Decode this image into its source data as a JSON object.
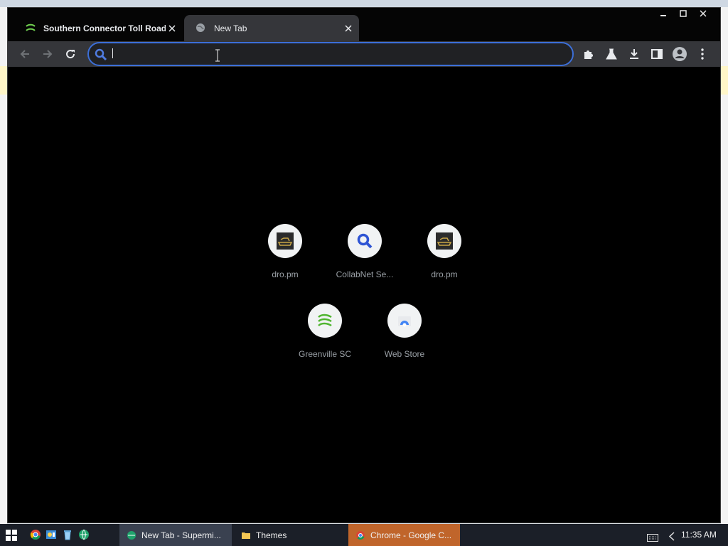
{
  "tabs": [
    {
      "title": "Southern Connector Toll Road -",
      "icon": "southern-connector-favicon",
      "close": "✕"
    },
    {
      "title": "New Tab",
      "icon": "globe-icon",
      "close": "✕"
    }
  ],
  "window_controls": {
    "minimize": "—",
    "maximize": "☐",
    "close": "✕"
  },
  "omnibox": {
    "value": "",
    "placeholder": ""
  },
  "shortcuts": [
    {
      "label": "dro.pm",
      "icon": "dro-pm-icon"
    },
    {
      "label": "CollabNet Se...",
      "icon": "search-icon"
    },
    {
      "label": "dro.pm",
      "icon": "dro-pm-icon"
    },
    {
      "label": "Greenville SC",
      "icon": "southern-connector-icon"
    },
    {
      "label": "Web Store",
      "icon": "web-store-icon"
    }
  ],
  "taskbar": {
    "items": [
      {
        "label": "New Tab - Supermi..."
      },
      {
        "label": "Themes"
      },
      {
        "label": "Chrome - Google C..."
      }
    ],
    "clock": "11:35 AM"
  },
  "colors": {
    "accent": "#3c6fd8",
    "toolbar": "#35363a",
    "page_bg": "#000000",
    "taskbar_active": "#c0652b"
  }
}
